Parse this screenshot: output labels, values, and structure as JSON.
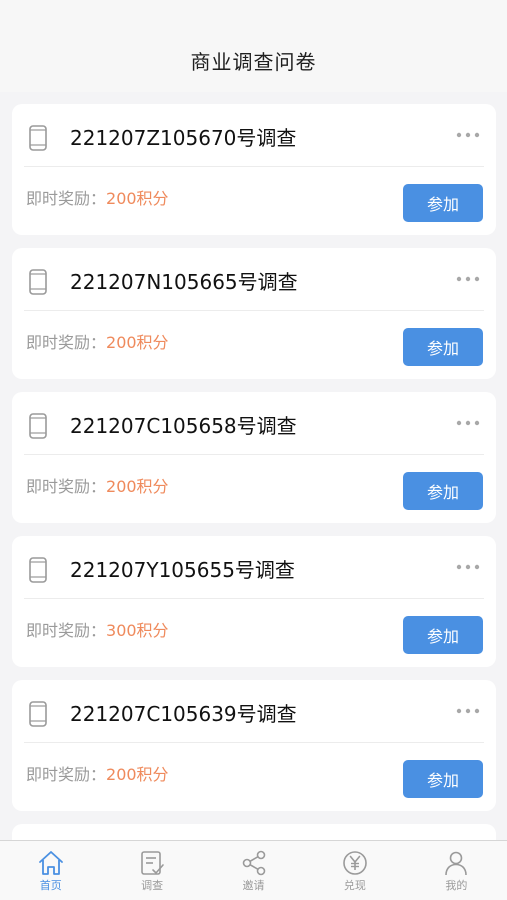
{
  "header": {
    "title": "商业调查问卷"
  },
  "surveys": [
    {
      "title": "221207Z105670号调查",
      "reward_label": "即时奖励：",
      "reward_value": "200积分",
      "join_label": "参加"
    },
    {
      "title": "221207N105665号调查",
      "reward_label": "即时奖励：",
      "reward_value": "200积分",
      "join_label": "参加"
    },
    {
      "title": "221207C105658号调查",
      "reward_label": "即时奖励：",
      "reward_value": "200积分",
      "join_label": "参加"
    },
    {
      "title": "221207Y105655号调查",
      "reward_label": "即时奖励：",
      "reward_value": "300积分",
      "join_label": "参加"
    },
    {
      "title": "221207C105639号调查",
      "reward_label": "即时奖励：",
      "reward_value": "200积分",
      "join_label": "参加"
    }
  ],
  "tabs": [
    {
      "label": "首页",
      "icon": "home-icon",
      "active": true
    },
    {
      "label": "调查",
      "icon": "survey-icon",
      "active": false
    },
    {
      "label": "邀请",
      "icon": "share-icon",
      "active": false
    },
    {
      "label": "兑现",
      "icon": "yen-icon",
      "active": false
    },
    {
      "label": "我的",
      "icon": "user-icon",
      "active": false
    }
  ],
  "colors": {
    "accent": "#4a90e2",
    "reward": "#ef8a5c",
    "muted": "#9a9a9a",
    "background": "#f4f4f6"
  }
}
